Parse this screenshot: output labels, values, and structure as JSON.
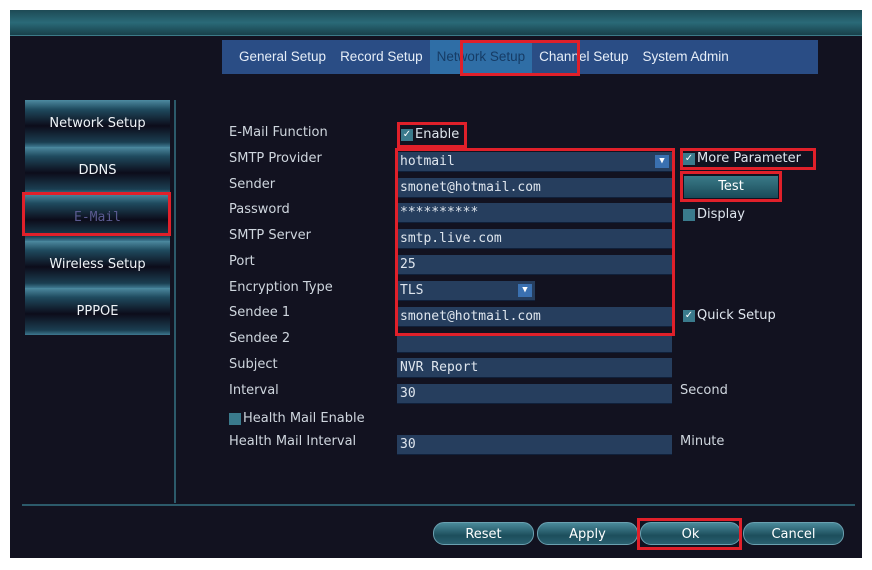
{
  "tabs": [
    "General Setup",
    "Record Setup",
    "Network Setup",
    "Channel Setup",
    "System Admin"
  ],
  "sidebar": [
    "Network Setup",
    "DDNS",
    "E-Mail",
    "Wireless Setup",
    "PPPOE"
  ],
  "labels": {
    "email_function": "E-Mail Function",
    "smtp_provider": "SMTP Provider",
    "sender": "Sender",
    "password": "Password",
    "smtp_server": "SMTP Server",
    "port": "Port",
    "encryption": "Encryption Type",
    "sendee1": "Sendee 1",
    "sendee2": "Sendee 2",
    "subject": "Subject",
    "interval": "Interval",
    "health_enable": "Health Mail Enable",
    "health_interval": "Health Mail Interval"
  },
  "values": {
    "smtp_provider": "hotmail",
    "sender": "smonet@hotmail.com",
    "password": "**********",
    "smtp_server": "smtp.live.com",
    "port": "25",
    "encryption": "TLS",
    "sendee1": "smonet@hotmail.com",
    "sendee2": "",
    "subject": "NVR Report",
    "interval": "30",
    "health_interval": "30"
  },
  "options": {
    "enable": "Enable",
    "more_parameter": "More Parameter",
    "display": "Display",
    "quick_setup": "Quick Setup"
  },
  "units": {
    "interval": "Second",
    "health": "Minute"
  },
  "test_label": "Test",
  "buttons": {
    "reset": "Reset",
    "apply": "Apply",
    "ok": "Ok",
    "cancel": "Cancel"
  }
}
